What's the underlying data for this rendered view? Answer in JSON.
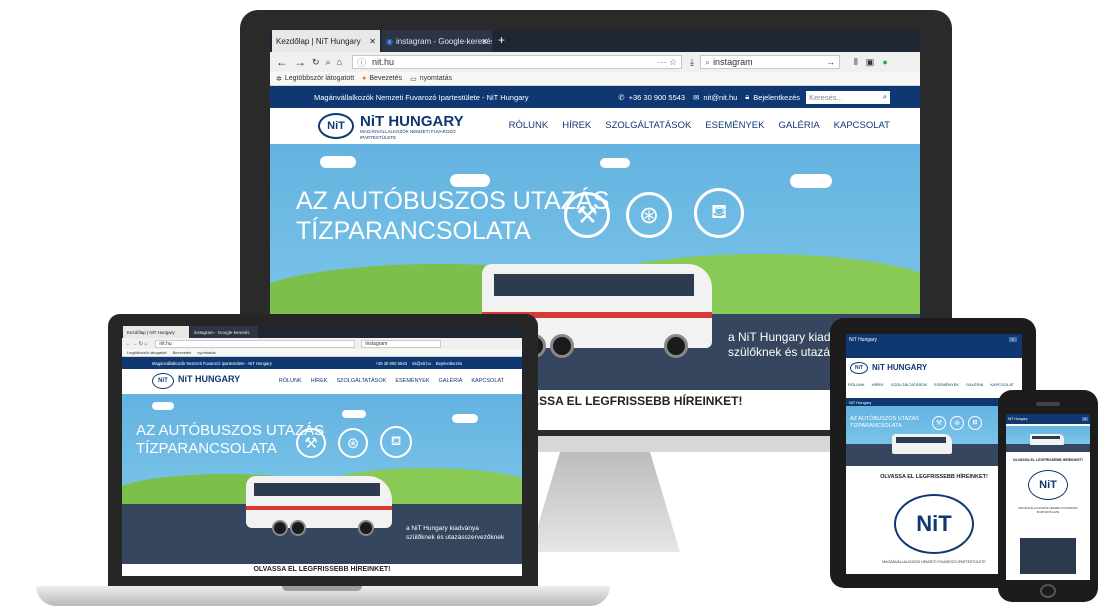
{
  "browser": {
    "tab1_title": "Kezdőlap | NiT Hungary",
    "tab2_title": "instagram - Google-keresés",
    "url": "nit.hu",
    "search_value": "instagram",
    "bookmark1": "Legtöbbször látogatott",
    "bookmark2": "Bevezetés",
    "bookmark3": "nyomtatás"
  },
  "site": {
    "topbar_title": "Magánvállalkozók Nemzeti Fuvarozó Ipartestülete - NiT Hungary",
    "phone": "+36 30 900 5543",
    "email": "nit@nit.hu",
    "login": "Bejelentkezés",
    "search_placeholder": "Keresés...",
    "logo_title": "NiT HUNGARY",
    "logo_subtitle": "MAGÁNVÁLLALKOZÓK NEMZETI FUVAROZÓ IPARTESTÜLETE",
    "logo_mark": "NiT",
    "nav": [
      "RÓLUNK",
      "HÍREK",
      "SZOLGÁLTATÁSOK",
      "ESEMÉNYEK",
      "GALÉRIA",
      "KAPCSOLAT"
    ],
    "hero_line1": "AZ AUTÓBUSZOS UTAZÁS",
    "hero_line2": "TÍZPARANCSOLATA",
    "hero_caption1": "a NiT Hungary kiadványa",
    "hero_caption2": "szülőknek és utazásszervezőknek",
    "news_heading": "OLVASSA EL LEGFRISSEBB HÍREINKET!",
    "mobile_brand": "NiT Hungary",
    "mobile_caption": "MAGÁNVÁLLALKOZÓK NEMZETI FUVAROZÓ IPARTESTÜLETE"
  },
  "colors": {
    "brand_blue": "#0f3872",
    "sky": "#78c3e8",
    "road": "#36465e",
    "grass": "#7cc04b"
  }
}
